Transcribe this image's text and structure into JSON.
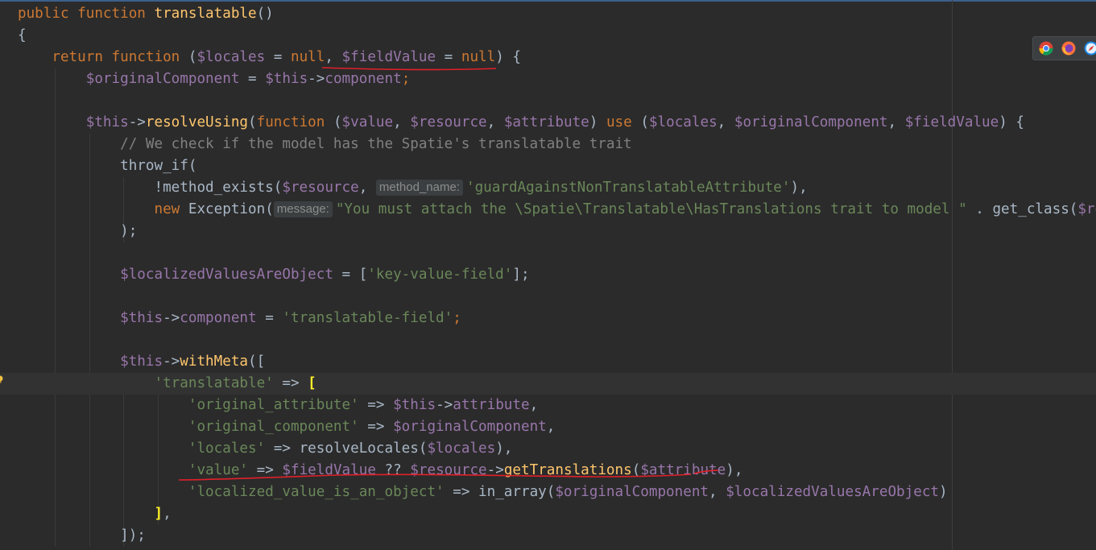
{
  "editor": {
    "lines": [
      {
        "indent": "",
        "tokens": [
          {
            "c": "kw",
            "t": "public function "
          },
          {
            "c": "fn",
            "t": "translatable"
          },
          {
            "c": "pl",
            "t": "()"
          }
        ]
      },
      {
        "indent": "",
        "tokens": [
          {
            "c": "pl",
            "t": "{"
          }
        ]
      },
      {
        "indent": "    ",
        "tokens": [
          {
            "c": "kw",
            "t": "return function "
          },
          {
            "c": "pl",
            "t": "("
          },
          {
            "c": "var",
            "t": "$locales"
          },
          {
            "c": "pl",
            "t": " = "
          },
          {
            "c": "kw",
            "t": "null"
          },
          {
            "c": "pl",
            "t": ", "
          },
          {
            "c": "var",
            "t": "$fieldValue"
          },
          {
            "c": "pl",
            "t": " = "
          },
          {
            "c": "kw",
            "t": "null"
          },
          {
            "c": "pl",
            "t": ") {"
          }
        ]
      },
      {
        "indent": "        ",
        "tokens": [
          {
            "c": "var",
            "t": "$originalComponent"
          },
          {
            "c": "pl",
            "t": " = "
          },
          {
            "c": "var",
            "t": "$this"
          },
          {
            "c": "pl",
            "t": "->"
          },
          {
            "c": "var",
            "t": "component"
          },
          {
            "c": "kw",
            "t": ";"
          }
        ]
      },
      {
        "indent": "",
        "tokens": []
      },
      {
        "indent": "        ",
        "tokens": [
          {
            "c": "var",
            "t": "$this"
          },
          {
            "c": "pl",
            "t": "->"
          },
          {
            "c": "fn",
            "t": "resolveUsing"
          },
          {
            "c": "pl",
            "t": "("
          },
          {
            "c": "kw",
            "t": "function "
          },
          {
            "c": "pl",
            "t": "("
          },
          {
            "c": "var",
            "t": "$value"
          },
          {
            "c": "pl",
            "t": ", "
          },
          {
            "c": "var",
            "t": "$resource"
          },
          {
            "c": "pl",
            "t": ", "
          },
          {
            "c": "var",
            "t": "$attribute"
          },
          {
            "c": "pl",
            "t": ") "
          },
          {
            "c": "kw",
            "t": "use "
          },
          {
            "c": "pl",
            "t": "("
          },
          {
            "c": "var",
            "t": "$locales"
          },
          {
            "c": "pl",
            "t": ", "
          },
          {
            "c": "var",
            "t": "$originalComponent"
          },
          {
            "c": "pl",
            "t": ", "
          },
          {
            "c": "var",
            "t": "$fieldValue"
          },
          {
            "c": "pl",
            "t": ") {"
          }
        ]
      },
      {
        "indent": "            ",
        "tokens": [
          {
            "c": "cm",
            "t": "// We check if the model has the Spatie's translatable trait"
          }
        ]
      },
      {
        "indent": "            ",
        "tokens": [
          {
            "c": "pl",
            "t": "throw_if("
          }
        ]
      },
      {
        "indent": "                ",
        "tokens": [
          {
            "c": "pl",
            "t": "!method_exists("
          },
          {
            "c": "var",
            "t": "$resource"
          },
          {
            "c": "pl",
            "t": ", "
          },
          {
            "c": "hint",
            "t": "method_name:"
          },
          {
            "c": "str",
            "t": "'guardAgainstNonTranslatableAttribute'"
          },
          {
            "c": "pl",
            "t": "),"
          }
        ]
      },
      {
        "indent": "                ",
        "tokens": [
          {
            "c": "kw",
            "t": "new "
          },
          {
            "c": "pl",
            "t": "Exception("
          },
          {
            "c": "hint",
            "t": "message:"
          },
          {
            "c": "str",
            "t": "\"You must attach the \\Spatie\\Translatable\\HasTranslations trait to model \""
          },
          {
            "c": "pl",
            "t": " . get_class("
          },
          {
            "c": "var",
            "t": "$resource"
          }
        ]
      },
      {
        "indent": "            ",
        "tokens": [
          {
            "c": "pl",
            "t": ");"
          }
        ]
      },
      {
        "indent": "",
        "tokens": []
      },
      {
        "indent": "            ",
        "tokens": [
          {
            "c": "var",
            "t": "$localizedValuesAreObject"
          },
          {
            "c": "pl",
            "t": " = ["
          },
          {
            "c": "str",
            "t": "'key-value-field'"
          },
          {
            "c": "pl",
            "t": "];"
          }
        ]
      },
      {
        "indent": "",
        "tokens": []
      },
      {
        "indent": "            ",
        "tokens": [
          {
            "c": "var",
            "t": "$this"
          },
          {
            "c": "pl",
            "t": "->"
          },
          {
            "c": "var",
            "t": "component"
          },
          {
            "c": "pl",
            "t": " = "
          },
          {
            "c": "str",
            "t": "'translatable-field'"
          },
          {
            "c": "kw",
            "t": ";"
          }
        ]
      },
      {
        "indent": "",
        "tokens": []
      },
      {
        "indent": "            ",
        "tokens": [
          {
            "c": "var",
            "t": "$this"
          },
          {
            "c": "pl",
            "t": "->"
          },
          {
            "c": "fn",
            "t": "withMeta"
          },
          {
            "c": "pl",
            "t": "(["
          }
        ]
      },
      {
        "indent": "                ",
        "current": true,
        "tokens": [
          {
            "c": "str",
            "t": "'translatable'"
          },
          {
            "c": "pl",
            "t": " => "
          },
          {
            "c": "brace-hl",
            "t": "["
          }
        ]
      },
      {
        "indent": "                    ",
        "tokens": [
          {
            "c": "str",
            "t": "'original_attribute'"
          },
          {
            "c": "pl",
            "t": " => "
          },
          {
            "c": "var",
            "t": "$this"
          },
          {
            "c": "pl",
            "t": "->"
          },
          {
            "c": "var",
            "t": "attribute"
          },
          {
            "c": "pl",
            "t": ","
          }
        ]
      },
      {
        "indent": "                    ",
        "tokens": [
          {
            "c": "str",
            "t": "'original_component'"
          },
          {
            "c": "pl",
            "t": " => "
          },
          {
            "c": "var",
            "t": "$originalComponent"
          },
          {
            "c": "pl",
            "t": ","
          }
        ]
      },
      {
        "indent": "                    ",
        "tokens": [
          {
            "c": "str",
            "t": "'locales'"
          },
          {
            "c": "pl",
            "t": " => resolveLocales("
          },
          {
            "c": "var",
            "t": "$locales"
          },
          {
            "c": "pl",
            "t": "),"
          }
        ]
      },
      {
        "indent": "                    ",
        "tokens": [
          {
            "c": "str",
            "t": "'value'"
          },
          {
            "c": "pl",
            "t": " => "
          },
          {
            "c": "var",
            "t": "$fieldValue"
          },
          {
            "c": "pl",
            "t": " ?? "
          },
          {
            "c": "var",
            "t": "$resource"
          },
          {
            "c": "pl",
            "t": "->"
          },
          {
            "c": "fn",
            "t": "getTranslations"
          },
          {
            "c": "pl",
            "t": "("
          },
          {
            "c": "var",
            "t": "$attribute"
          },
          {
            "c": "pl",
            "t": "),"
          }
        ]
      },
      {
        "indent": "                    ",
        "tokens": [
          {
            "c": "str",
            "t": "'localized_value_is_an_object'"
          },
          {
            "c": "pl",
            "t": " => in_array("
          },
          {
            "c": "var",
            "t": "$originalComponent"
          },
          {
            "c": "pl",
            "t": ", "
          },
          {
            "c": "var",
            "t": "$localizedValuesAreObject"
          },
          {
            "c": "pl",
            "t": ")"
          }
        ]
      },
      {
        "indent": "                ",
        "tokens": [
          {
            "c": "brace-hl",
            "t": "]"
          },
          {
            "c": "pl",
            "t": ","
          }
        ]
      },
      {
        "indent": "            ",
        "tokens": [
          {
            "c": "pl",
            "t": "]);"
          }
        ]
      }
    ]
  },
  "browser_icons": [
    "chrome-icon",
    "firefox-icon",
    "safari-icon"
  ]
}
